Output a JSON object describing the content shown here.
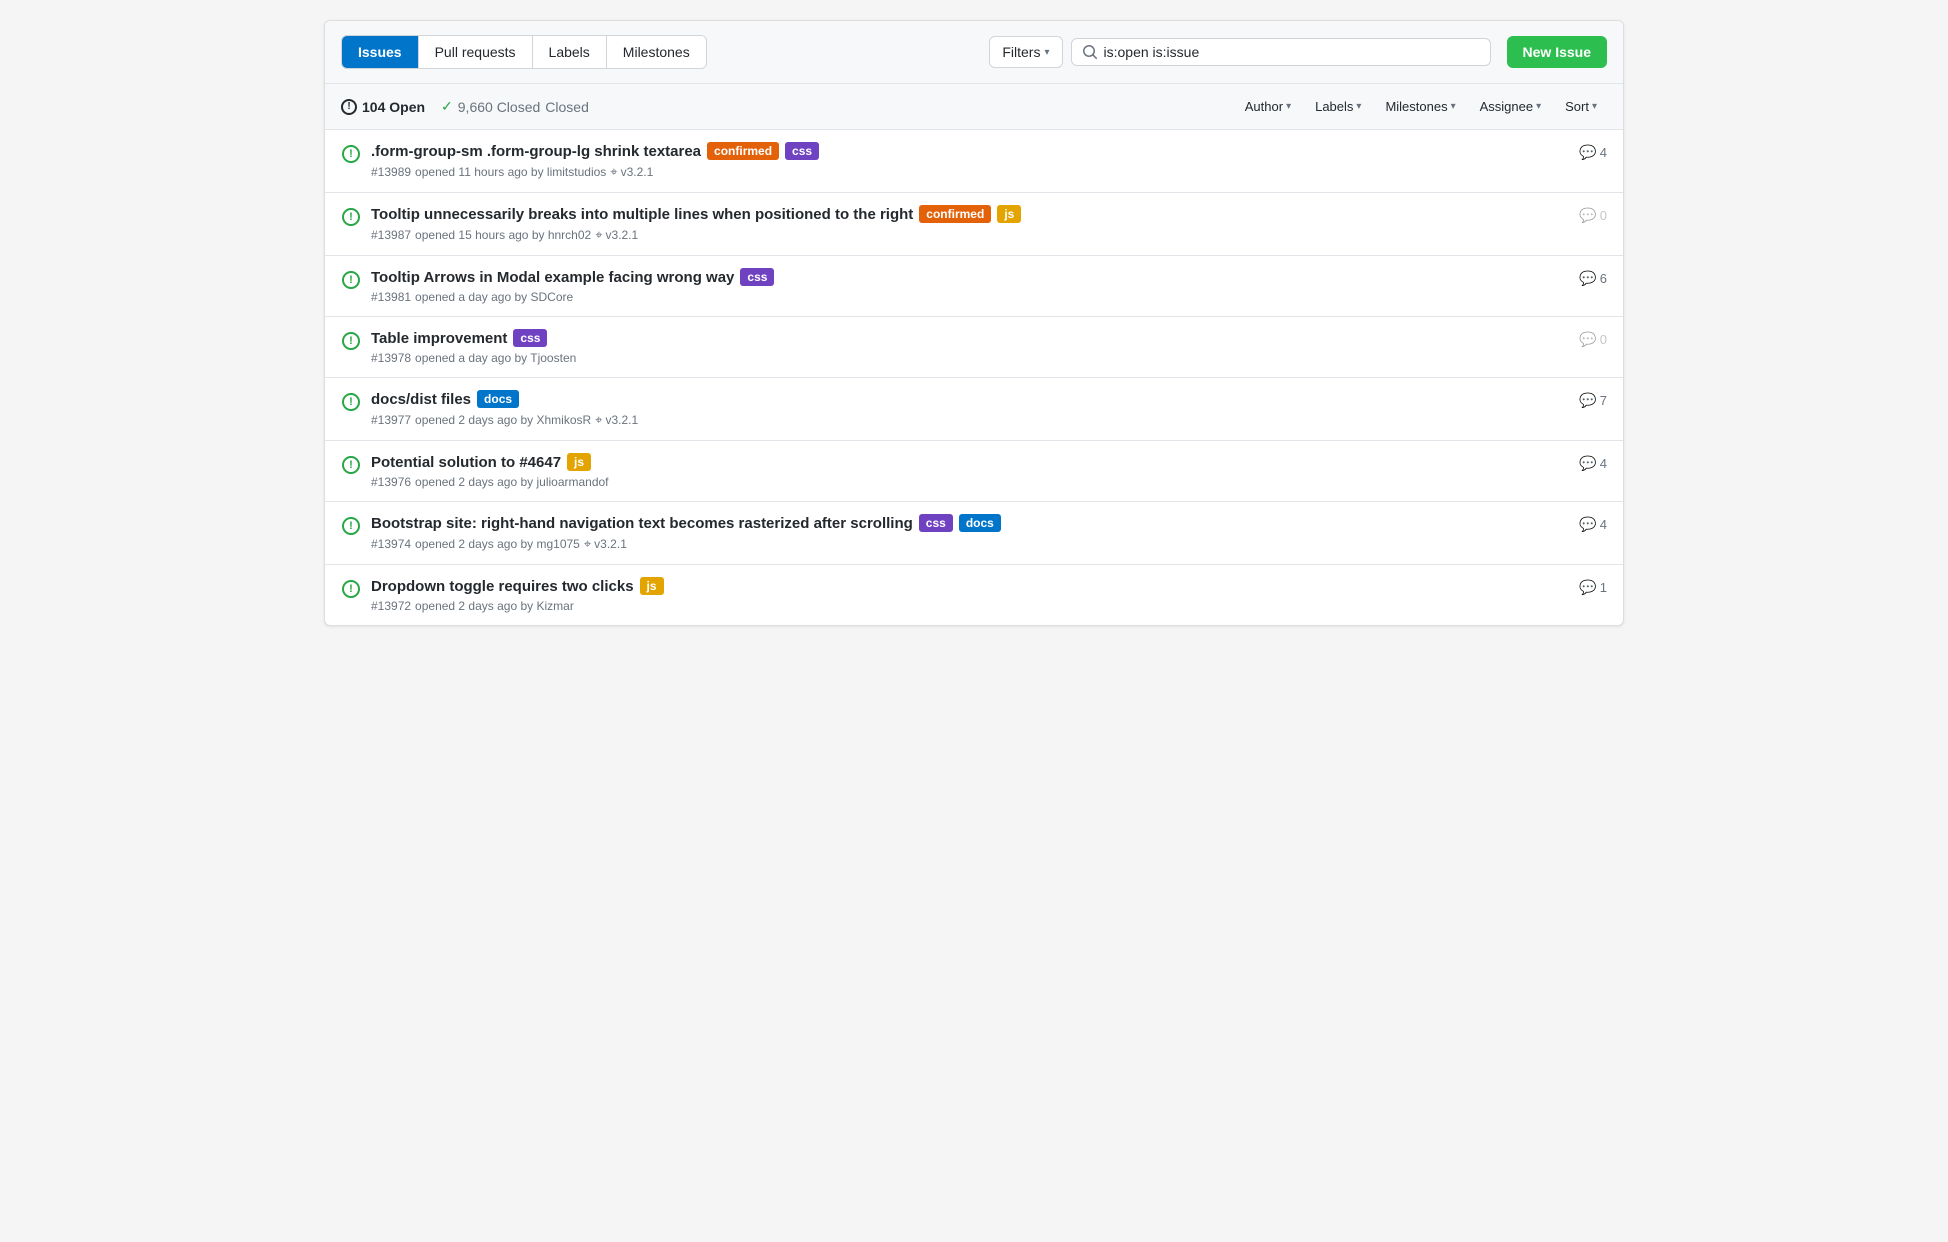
{
  "tabs": [
    {
      "label": "Issues",
      "active": true
    },
    {
      "label": "Pull requests",
      "active": false
    },
    {
      "label": "Labels",
      "active": false
    },
    {
      "label": "Milestones",
      "active": false
    }
  ],
  "filters_button": "Filters",
  "search_value": "is:open is:issue",
  "new_issue_button": "New Issue",
  "open_count": "104 Open",
  "closed_count": "9,660 Closed",
  "filter_labels": {
    "author": "Author",
    "labels": "Labels",
    "milestones": "Milestones",
    "assignee": "Assignee",
    "sort": "Sort"
  },
  "issues": [
    {
      "id": "#13989",
      "title": ".form-group-sm .form-group-lg shrink textarea",
      "badges": [
        {
          "label": "confirmed",
          "type": "confirmed"
        },
        {
          "label": "css",
          "type": "css"
        }
      ],
      "meta": "opened 11 hours ago by limitstudios",
      "milestone": "v3.2.1",
      "comments": 4,
      "comments_zero": false
    },
    {
      "id": "#13987",
      "title": "Tooltip unnecessarily breaks into multiple lines when positioned to the right",
      "badges": [
        {
          "label": "confirmed",
          "type": "confirmed"
        },
        {
          "label": "js",
          "type": "js"
        }
      ],
      "meta": "opened 15 hours ago by hnrch02",
      "milestone": "v3.2.1",
      "comments": 0,
      "comments_zero": true
    },
    {
      "id": "#13981",
      "title": "Tooltip Arrows in Modal example facing wrong way",
      "badges": [
        {
          "label": "css",
          "type": "css"
        }
      ],
      "meta": "opened a day ago by SDCore",
      "milestone": null,
      "comments": 6,
      "comments_zero": false
    },
    {
      "id": "#13978",
      "title": "Table improvement",
      "badges": [
        {
          "label": "css",
          "type": "css"
        }
      ],
      "meta": "opened a day ago by Tjoosten",
      "milestone": null,
      "comments": 0,
      "comments_zero": true
    },
    {
      "id": "#13977",
      "title": "docs/dist files",
      "badges": [
        {
          "label": "docs",
          "type": "docs"
        }
      ],
      "meta": "opened 2 days ago by XhmikosR",
      "milestone": "v3.2.1",
      "comments": 7,
      "comments_zero": false
    },
    {
      "id": "#13976",
      "title": "Potential solution to #4647",
      "badges": [
        {
          "label": "js",
          "type": "js"
        }
      ],
      "meta": "opened 2 days ago by julioarmandof",
      "milestone": null,
      "comments": 4,
      "comments_zero": false
    },
    {
      "id": "#13974",
      "title": "Bootstrap site: right-hand navigation text becomes rasterized after scrolling",
      "badges": [
        {
          "label": "css",
          "type": "css"
        },
        {
          "label": "docs",
          "type": "docs"
        }
      ],
      "meta": "opened 2 days ago by mg1075",
      "milestone": "v3.2.1",
      "comments": 4,
      "comments_zero": false
    },
    {
      "id": "#13972",
      "title": "Dropdown toggle requires two clicks",
      "badges": [
        {
          "label": "js",
          "type": "js"
        }
      ],
      "meta": "opened 2 days ago by Kizmar",
      "milestone": null,
      "comments": 1,
      "comments_zero": false
    }
  ]
}
